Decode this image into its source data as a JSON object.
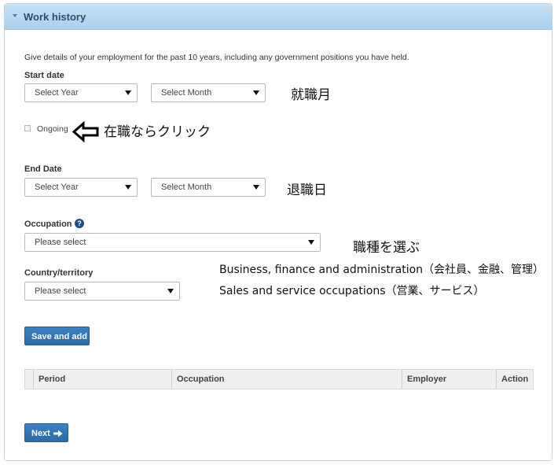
{
  "panel": {
    "title": "Work history"
  },
  "intro": "Give details of your employment for the past 10 years, including any government positions you have held.",
  "start_date": {
    "label": "Start date",
    "year": "Select Year",
    "month": "Select Month",
    "note": "就職月"
  },
  "ongoing": {
    "label": "Ongoing",
    "note": "在職ならクリック"
  },
  "end_date": {
    "label": "End Date",
    "year": "Select Year",
    "month": "Select Month",
    "note": "退職日"
  },
  "occupation": {
    "label": "Occupation",
    "help": "?",
    "value": "Please select",
    "note": "職種を選ぶ",
    "examples": [
      "Business, finance and administration（会社員、金融、管理）",
      "Sales and service occupations（営業、サービス）"
    ]
  },
  "country": {
    "label": "Country/territory",
    "value": "Please select"
  },
  "buttons": {
    "save_add": "Save and add",
    "next": "Next"
  },
  "table": {
    "headers": [
      "Period",
      "Occupation",
      "Employer",
      "Action"
    ]
  }
}
